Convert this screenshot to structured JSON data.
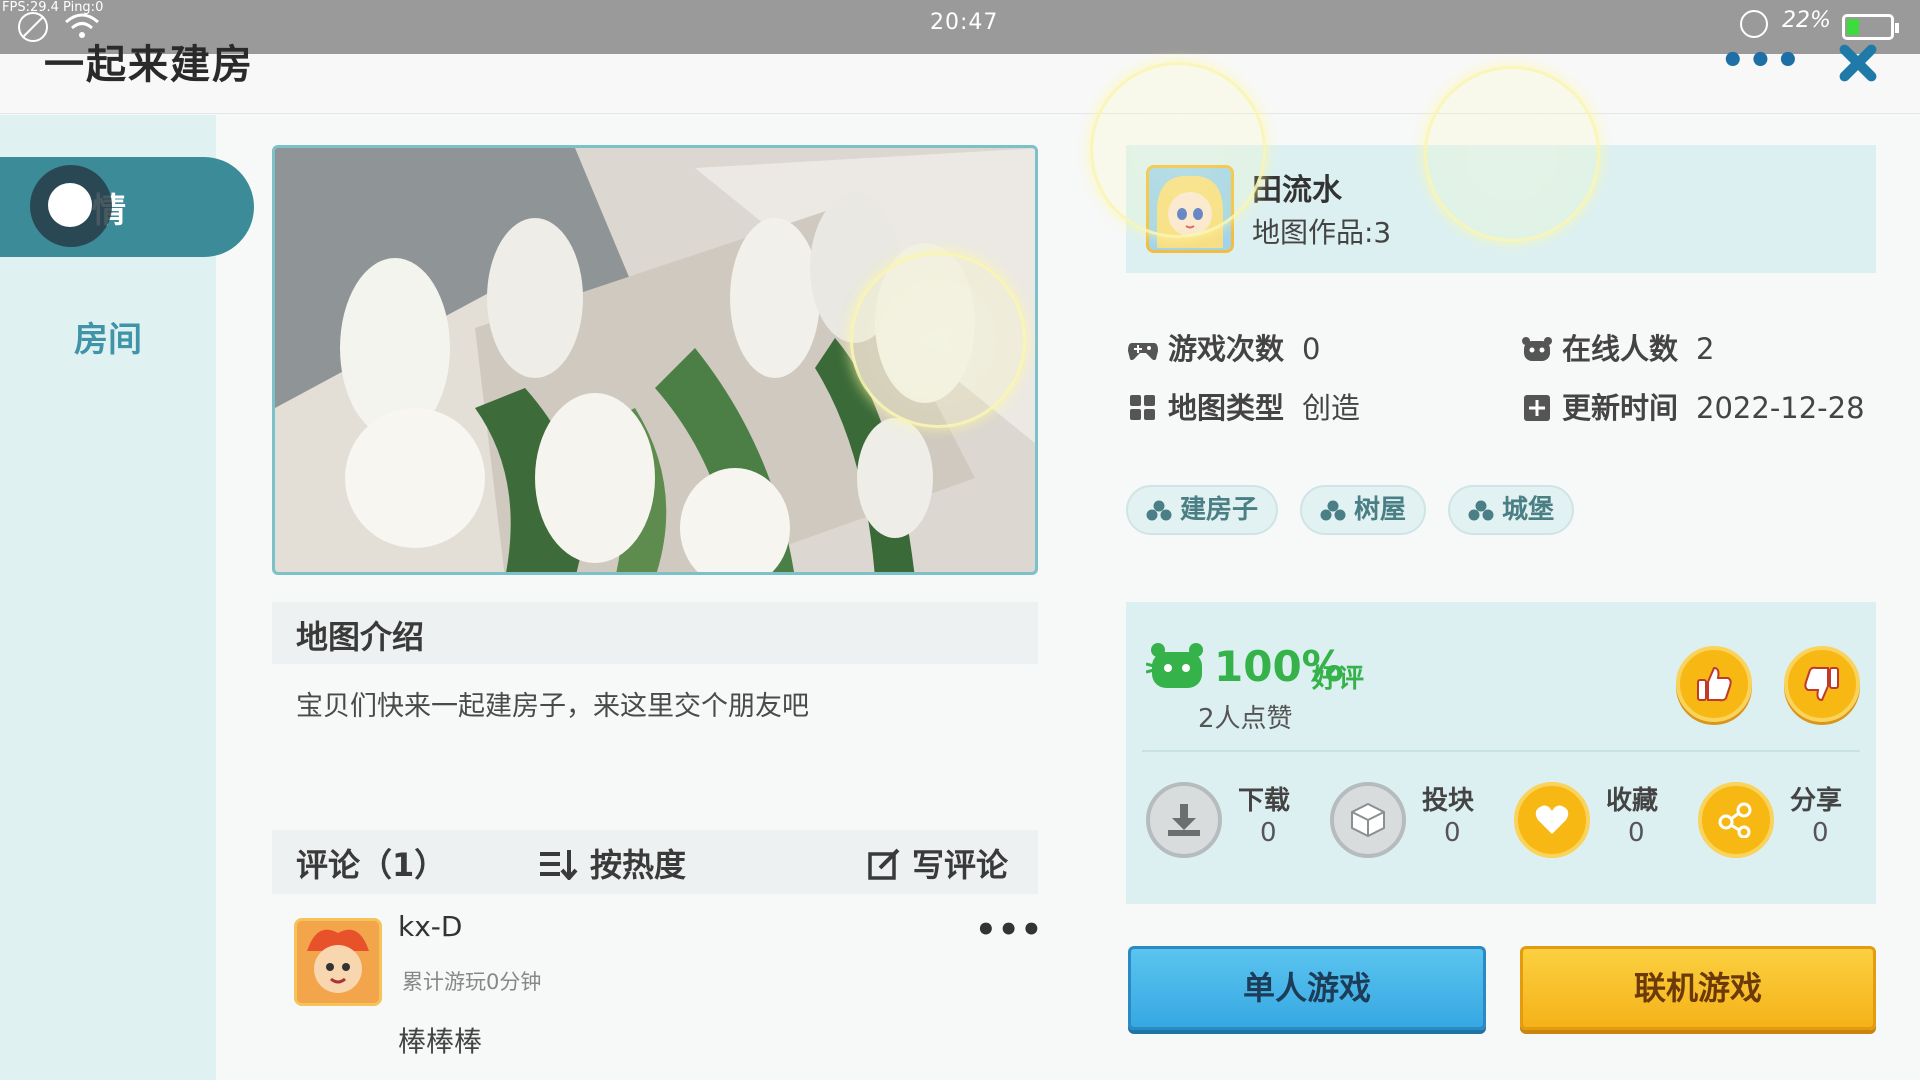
{
  "status_bar": {
    "debug": "FPS:29.4  Ping:0",
    "time": "20:47",
    "battery_pct": "22%",
    "battery_level": 0.22
  },
  "header": {
    "title": "一起来建房",
    "more_label": "•••"
  },
  "sidebar": {
    "items": [
      {
        "label": "详情",
        "visible_label": "情",
        "active": true
      },
      {
        "label": "房间",
        "active": false
      }
    ]
  },
  "intro": {
    "title": "地图介绍",
    "text": "宝贝们快来一起建房子，来这里交个朋友吧"
  },
  "comments": {
    "title": "评论（1）",
    "sort_label": "按热度",
    "write_label": "写评论",
    "items": [
      {
        "user": "kx-D",
        "playtime": "累计游玩0分钟",
        "text": "棒棒棒",
        "more": "•••"
      }
    ]
  },
  "author": {
    "name": "田流水",
    "works": "地图作品:3"
  },
  "stats": {
    "plays_label": "游戏次数",
    "plays_value": "0",
    "online_label": "在线人数",
    "online_value": "2",
    "type_label": "地图类型",
    "type_value": "创造",
    "updated_label": "更新时间",
    "updated_value": "2022-12-28"
  },
  "tags": [
    "建房子",
    "树屋",
    "城堡"
  ],
  "rating": {
    "percent": "100%",
    "good_label": "好评",
    "likes": "2人点赞"
  },
  "actions": [
    {
      "label": "下载",
      "count": "0",
      "icon": "download-icon",
      "style": "gray"
    },
    {
      "label": "投块",
      "count": "0",
      "icon": "block-icon",
      "style": "gray"
    },
    {
      "label": "收藏",
      "count": "0",
      "icon": "heart-icon",
      "style": "gold"
    },
    {
      "label": "分享",
      "count": "0",
      "icon": "share-icon",
      "style": "gold"
    }
  ],
  "buttons": {
    "single": "单人游戏",
    "multi": "联机游戏"
  },
  "colors": {
    "accent_teal": "#3b8c98",
    "panel_bg": "#dcf0f2",
    "gold": "#f7b814",
    "good_green": "#35b24a",
    "single_blue": "#36a8e2",
    "multi_yellow": "#f5b219"
  }
}
